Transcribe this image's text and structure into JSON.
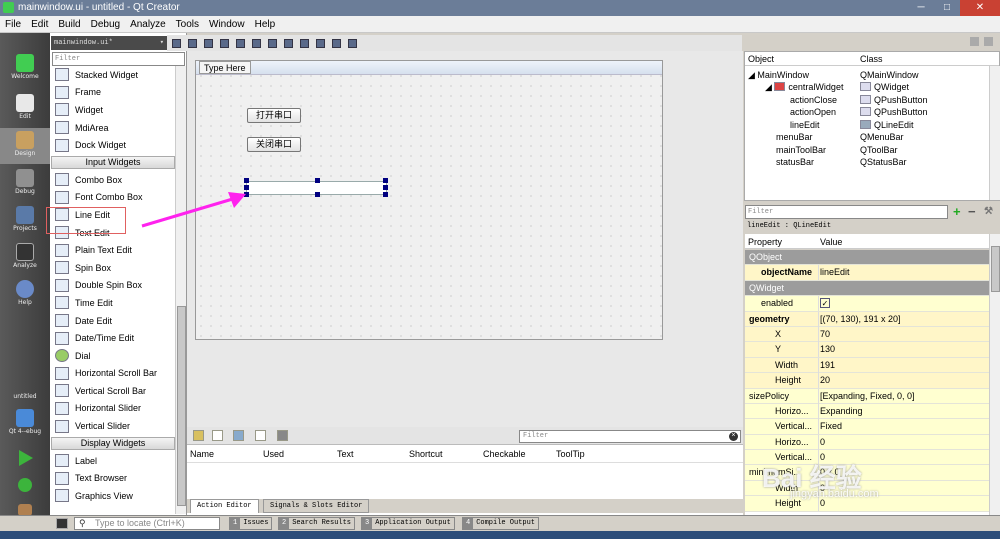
{
  "window": {
    "title": "mainwindow.ui - untitled - Qt Creator"
  },
  "menu": [
    "File",
    "Edit",
    "Build",
    "Debug",
    "Analyze",
    "Tools",
    "Window",
    "Help"
  ],
  "modes": [
    "Welcome",
    "Edit",
    "Design",
    "Debug",
    "Projects",
    "Analyze",
    "Help"
  ],
  "kit": {
    "project": "untitled",
    "config": "Qt 4--ebug"
  },
  "editor": {
    "file": "mainwindow.ui*",
    "filter_placeholder": "Filter"
  },
  "widgets": {
    "items_top": [
      "Stacked Widget",
      "Frame",
      "Widget",
      "MdiArea",
      "Dock Widget"
    ],
    "cat_input": "Input Widgets",
    "items_input": [
      "Combo Box",
      "Font Combo Box",
      "Line Edit",
      "Text Edit",
      "Plain Text Edit",
      "Spin Box",
      "Double Spin Box",
      "Time Edit",
      "Date Edit",
      "Date/Time Edit",
      "Dial",
      "Horizontal Scroll Bar",
      "Vertical Scroll Bar",
      "Horizontal Slider",
      "Vertical Slider"
    ],
    "cat_display": "Display Widgets",
    "items_display": [
      "Label",
      "Text Browser",
      "Graphics View"
    ]
  },
  "form": {
    "menu_placeholder": "Type Here",
    "btn_open": "打开串口",
    "btn_close": "关闭串口"
  },
  "action_editor": {
    "filter_placeholder": "Filter",
    "columns": [
      "Name",
      "Used",
      "Text",
      "Shortcut",
      "Checkable",
      "ToolTip"
    ],
    "tabs": [
      "Action Editor",
      "Signals & Slots Editor"
    ]
  },
  "object_inspector": {
    "headers": [
      "Object",
      "Class"
    ],
    "rows": [
      {
        "object": "MainWindow",
        "class": "QMainWindow"
      },
      {
        "object": "centralWidget",
        "class": "QWidget"
      },
      {
        "object": "actionClose",
        "class": "QPushButton"
      },
      {
        "object": "actionOpen",
        "class": "QPushButton"
      },
      {
        "object": "lineEdit",
        "class": "QLineEdit"
      },
      {
        "object": "menuBar",
        "class": "QMenuBar"
      },
      {
        "object": "mainToolBar",
        "class": "QToolBar"
      },
      {
        "object": "statusBar",
        "class": "QStatusBar"
      }
    ]
  },
  "property_editor": {
    "filter_placeholder": "Filter",
    "object_line": "lineEdit : QLineEdit",
    "headers": [
      "Property",
      "Value"
    ],
    "rows": [
      {
        "name": "QObject",
        "value": ""
      },
      {
        "name": "objectName",
        "value": "lineEdit"
      },
      {
        "name": "QWidget",
        "value": ""
      },
      {
        "name": "enabled",
        "value": "✓"
      },
      {
        "name": "geometry",
        "value": "[(70, 130), 191 x 20]"
      },
      {
        "name": "X",
        "value": "70"
      },
      {
        "name": "Y",
        "value": "130"
      },
      {
        "name": "Width",
        "value": "191"
      },
      {
        "name": "Height",
        "value": "20"
      },
      {
        "name": "sizePolicy",
        "value": "[Expanding, Fixed, 0, 0]"
      },
      {
        "name": "Horizo...",
        "value": "Expanding"
      },
      {
        "name": "Vertical...",
        "value": "Fixed"
      },
      {
        "name": "Horizo...",
        "value": "0"
      },
      {
        "name": "Vertical...",
        "value": "0"
      },
      {
        "name": "minimumSi...",
        "value": "0 x 0"
      },
      {
        "name": "Width",
        "value": "0"
      },
      {
        "name": "Height",
        "value": "0"
      }
    ]
  },
  "statusbar": {
    "locate_placeholder": "Type to locate (Ctrl+K)",
    "tabs": [
      {
        "num": "1",
        "label": "Issues"
      },
      {
        "num": "2",
        "label": "Search Results"
      },
      {
        "num": "3",
        "label": "Application Output"
      },
      {
        "num": "4",
        "label": "Compile Output"
      }
    ]
  },
  "watermark": {
    "brand": "Bai 经验",
    "url": "jingyan.baidu.com"
  }
}
